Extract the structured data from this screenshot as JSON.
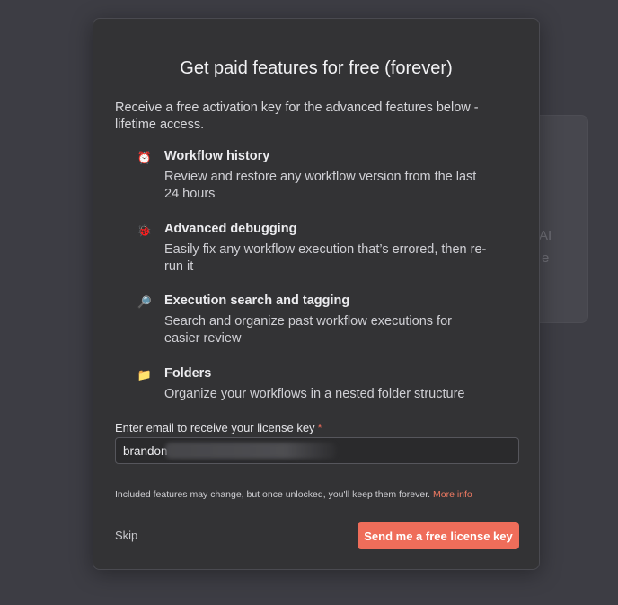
{
  "background": {
    "fragment_1": "AI",
    "fragment_2": "e"
  },
  "modal": {
    "title": "Get paid features for free (forever)",
    "intro": "Receive a free activation key for the advanced features below - lifetime access.",
    "features": [
      {
        "icon": "alarm-clock-icon",
        "glyph": "⏰",
        "title": "Workflow history",
        "description": "Review and restore any workflow version from the last 24 hours"
      },
      {
        "icon": "bug-icon",
        "glyph": "🐞",
        "title": "Advanced debugging",
        "description": "Easily fix any workflow execution that’s errored, then re-run it"
      },
      {
        "icon": "magnifier-icon",
        "glyph": "🔎",
        "title": "Execution search and tagging",
        "description": "Search and organize past workflow executions for easier review"
      },
      {
        "icon": "folder-icon",
        "glyph": "📁",
        "title": "Folders",
        "description": "Organize your workflows in a nested folder structure"
      }
    ],
    "email": {
      "label": "Enter email to receive your license key",
      "required_marker": "*",
      "value": "brandon"
    },
    "disclaimer": "Included features may change, but once unlocked, you'll keep them forever.",
    "more_info_link": "More info",
    "skip_label": "Skip",
    "send_button_label": "Send me a free license key"
  },
  "colors": {
    "accent": "#ef6d5a",
    "modal_bg": "#333335",
    "backdrop": "#3d3d44"
  }
}
